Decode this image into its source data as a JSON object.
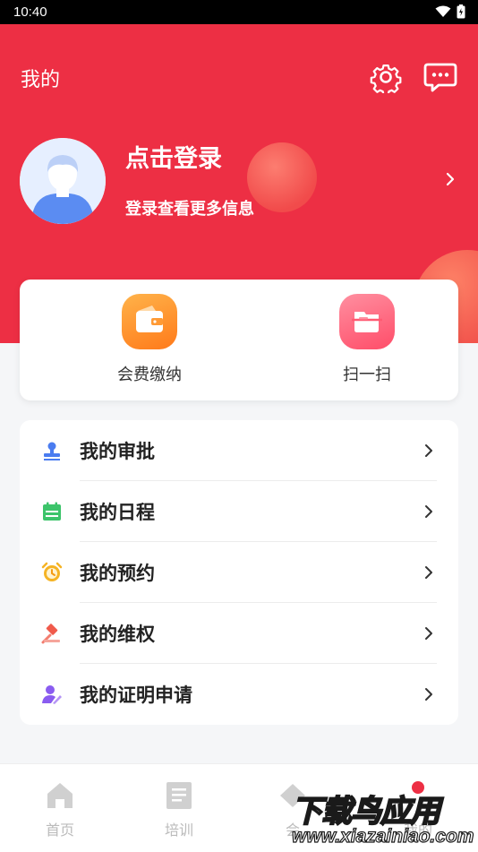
{
  "status": {
    "time": "10:40"
  },
  "header": {
    "title": "我的",
    "login_title": "点击登录",
    "login_subtitle": "登录查看更多信息"
  },
  "quick_actions": [
    {
      "label": "会费缴纳",
      "icon": "wallet-icon"
    },
    {
      "label": "扫一扫",
      "icon": "scan-icon"
    }
  ],
  "menu": [
    {
      "label": "我的审批",
      "icon": "approval-stamp-icon",
      "color": "#4a7cf0"
    },
    {
      "label": "我的日程",
      "icon": "calendar-icon",
      "color": "#3cc46a"
    },
    {
      "label": "我的预约",
      "icon": "alarm-clock-icon",
      "color": "#f5b324"
    },
    {
      "label": "我的维权",
      "icon": "gavel-icon",
      "color": "#f05a4b"
    },
    {
      "label": "我的证明申请",
      "icon": "pen-user-icon",
      "color": "#8a5cf0"
    }
  ],
  "tabbar": {
    "items": [
      {
        "label": "首页",
        "icon": "home-icon"
      },
      {
        "label": "培训",
        "icon": "book-icon"
      },
      {
        "label": "会",
        "icon": "member-icon"
      },
      {
        "label": "",
        "icon": "message-icon"
      },
      {
        "label": "我的",
        "icon": "profile-icon"
      }
    ]
  },
  "watermark": {
    "brand": "下载鸟应用",
    "url": "www.xiazainiao.com"
  },
  "colors": {
    "primary": "#ed2f44",
    "background": "#f5f6f8"
  }
}
